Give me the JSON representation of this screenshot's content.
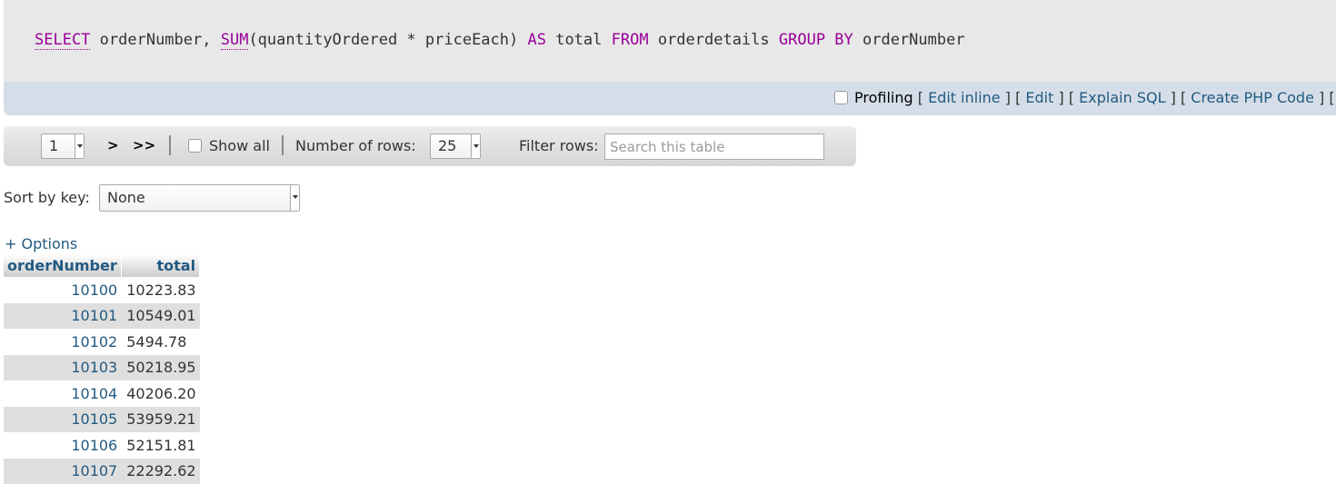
{
  "sql": {
    "select": "SELECT",
    "col1": " orderNumber, ",
    "sum": "SUM",
    "expr": "(quantityOrdered * priceEach) ",
    "as": "AS",
    "alias": " total ",
    "from": "FROM",
    "table": " orderdetails ",
    "groupby": "GROUP BY",
    "groupcol": " orderNumber"
  },
  "tools": {
    "profiling": "Profiling",
    "open": "[",
    "close": "]",
    "edit_inline": "Edit inline",
    "edit": "Edit",
    "explain": "Explain SQL",
    "php": "Create PHP Code",
    "trailing": "] [ F"
  },
  "nav": {
    "page_value": "1",
    "next": ">",
    "last": ">>",
    "show_all": "Show all",
    "rows_label": "Number of rows:",
    "rows_value": "25",
    "filter_label": "Filter rows:",
    "filter_placeholder": "Search this table"
  },
  "sort": {
    "label": "Sort by key:",
    "value": "None"
  },
  "options_label": "+ Options",
  "table": {
    "headers": [
      "orderNumber",
      "total"
    ],
    "rows": [
      [
        "10100",
        "10223.83"
      ],
      [
        "10101",
        "10549.01"
      ],
      [
        "10102",
        "5494.78"
      ],
      [
        "10103",
        "50218.95"
      ],
      [
        "10104",
        "40206.20"
      ],
      [
        "10105",
        "53959.21"
      ],
      [
        "10106",
        "52151.81"
      ],
      [
        "10107",
        "22292.62"
      ]
    ]
  }
}
